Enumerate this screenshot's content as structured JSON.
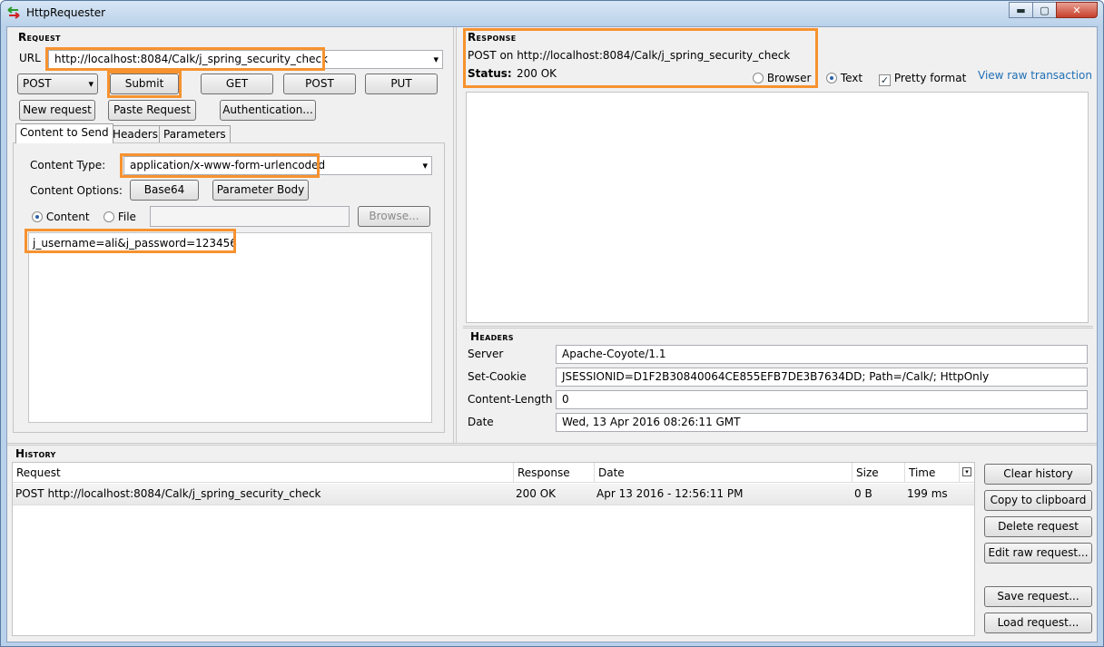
{
  "window": {
    "title": "HttpRequester",
    "minimize_glyph": "▬",
    "maximize_glyph": "▢",
    "close_glyph": "✕"
  },
  "request": {
    "section_label": "Request",
    "url_label": "URL",
    "url_value": "http://localhost:8084/Calk/j_spring_security_check",
    "method": "POST",
    "buttons": {
      "submit": "Submit",
      "get": "GET",
      "post": "POST",
      "put": "PUT",
      "new_request": "New request",
      "paste_request": "Paste Request",
      "authentication": "Authentication..."
    },
    "tabs": [
      "Content to Send",
      "Headers",
      "Parameters"
    ],
    "content_type_label": "Content Type:",
    "content_type_value": "application/x-www-form-urlencoded",
    "content_options_label": "Content Options:",
    "base64_button": "Base64",
    "parameter_body_button": "Parameter Body",
    "content_radio": "Content",
    "file_radio": "File",
    "file_path": "",
    "browse_button": "Browse...",
    "body_text": "j_username=ali&j_password=123456"
  },
  "response": {
    "section_label": "Response",
    "summary": "POST on http://localhost:8084/Calk/j_spring_security_check",
    "status_label": "Status:",
    "status_value": "200 OK",
    "view_browser": "Browser",
    "view_text": "Text",
    "pretty_format": "Pretty format",
    "view_raw_link": "View raw transaction",
    "body": "",
    "headers_label": "Headers",
    "headers": [
      {
        "name": "Server",
        "value": "Apache-Coyote/1.1"
      },
      {
        "name": "Set-Cookie",
        "value": "JSESSIONID=D1F2B30840064CE855EFB7DE3B7634DD; Path=/Calk/; HttpOnly"
      },
      {
        "name": "Content-Length",
        "value": "0"
      },
      {
        "name": "Date",
        "value": "Wed, 13 Apr 2016 08:26:11 GMT"
      }
    ]
  },
  "history": {
    "section_label": "History",
    "columns": {
      "request": "Request",
      "response": "Response",
      "date": "Date",
      "size": "Size",
      "time": "Time"
    },
    "rows": [
      {
        "request": "POST http://localhost:8084/Calk/j_spring_security_check",
        "response": "200 OK",
        "date": "Apr 13 2016 - 12:56:11 PM",
        "size": "0 B",
        "time": "199 ms"
      }
    ],
    "buttons": {
      "clear": "Clear history",
      "copy": "Copy to clipboard",
      "delete": "Delete request",
      "edit": "Edit raw request...",
      "save": "Save request...",
      "load": "Load request..."
    }
  },
  "colors": {
    "highlight": "#f7922f",
    "link": "#1f6fb5",
    "title_bar": "#bcd3ea"
  }
}
